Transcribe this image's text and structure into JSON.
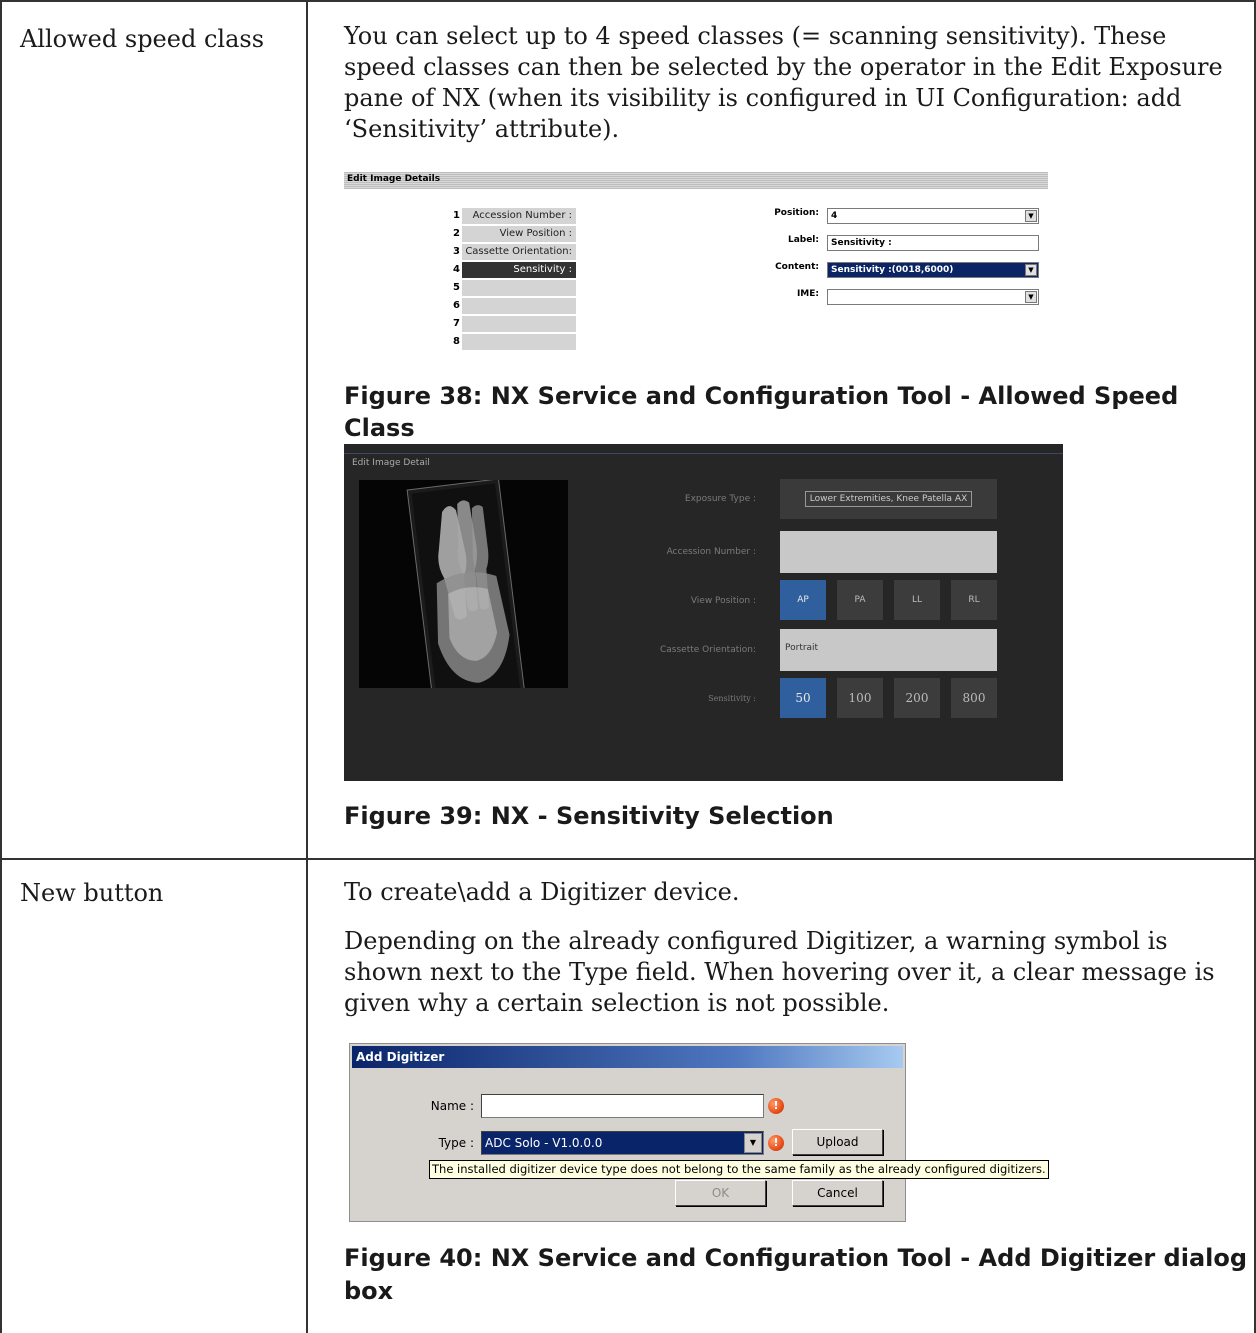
{
  "rows": [
    {
      "label": "Allowed speed class",
      "paragraph": "You can select up to 4 speed classes (= scanning sensitivity). These speed classes can then be selected by the operator in the Edit Exposure pane of NX (when its visibility is configured in UI Configuration: add ‘Sensitivity’ attribute).",
      "paragraph_lines": [
        "You can select up to 4 speed classes (= scanning sensitivity). These",
        "speed classes can then be selected by the operator in the Edit Exposure",
        "pane of NX (when its visibility is configured in UI Configuration: add",
        "‘Sensitivity’ attribute)."
      ],
      "figure38_caption": "Figure 38: NX Service and Configuration Tool - Allowed Speed Class",
      "figure39_caption": "Figure 39: NX - Sensitivity Selection"
    },
    {
      "label": "New button",
      "paragraph1": "To create\\add a Digitizer device.",
      "paragraph2_lines": [
        "Depending on the already configured Digitizer, a warning symbol is",
        "shown next to the Type field. When hovering over it, a clear message is",
        "given why a certain selection is not possible."
      ],
      "figure40_caption_lines": [
        "Figure 40: NX Service and Configuration Tool - Add Digitizer dialog",
        "box"
      ]
    }
  ],
  "fig38": {
    "title": "Edit Image Details",
    "list": [
      {
        "num": "1",
        "label": "Accession Number :"
      },
      {
        "num": "2",
        "label": "View Position :"
      },
      {
        "num": "3",
        "label": "Cassette Orientation:"
      },
      {
        "num": "4",
        "label": "Sensitivity :"
      },
      {
        "num": "5",
        "label": ""
      },
      {
        "num": "6",
        "label": ""
      },
      {
        "num": "7",
        "label": ""
      },
      {
        "num": "8",
        "label": ""
      }
    ],
    "selected_index": 3,
    "fields": {
      "position_label": "Position:",
      "position_value": "4",
      "label_label": "Label:",
      "label_value": "Sensitivity :",
      "content_label": "Content:",
      "content_value": "Sensitivity :(0018,6000)",
      "ime_label": "IME:",
      "ime_value": ""
    },
    "dropdown_glyph": "▼"
  },
  "fig39": {
    "title": "Edit Image Detail",
    "exposure_type_label": "Exposure Type :",
    "exposure_type_value": "Lower Extremities, Knee Patella AX",
    "accession_label": "Accession Number :",
    "view_position_label": "View Position :",
    "view_positions": [
      "AP",
      "PA",
      "LL",
      "RL"
    ],
    "cassette_label": "Cassette Orientation:",
    "cassette_value": "Portrait",
    "sensitivity_label": "Sensitivity :",
    "sensitivities": [
      "50",
      "100",
      "200",
      "800"
    ]
  },
  "fig40": {
    "title": "Add Digitizer",
    "name_label": "Name :",
    "name_value": "",
    "type_label": "Type :",
    "type_value": "ADC Solo - V1.0.0.0",
    "warn_glyph": "!",
    "upload_label": "Upload",
    "tooltip": "The installed digitizer device type does not belong to the same family as the already configured digitizers.",
    "ok_label": "OK",
    "cancel_label": "Cancel"
  },
  "colors": {
    "selected_blue": "#2f5f9c",
    "warning_orange": "#e8501a",
    "titlebar_blue": "#0a246a"
  }
}
